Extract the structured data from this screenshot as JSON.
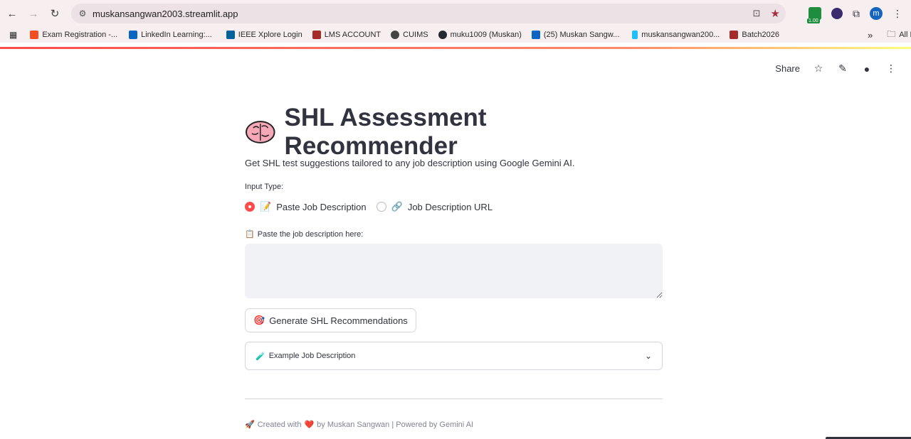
{
  "browser": {
    "url": "muskansangwan2003.streamlit.app",
    "back_icon": "arrow-left-icon",
    "forward_icon": "arrow-right-icon",
    "reload_icon": "reload-icon",
    "extension_badge": "1.00",
    "avatar_letter": "m"
  },
  "bookmarks": [
    {
      "label": "Exam Registration -...",
      "color": "#f25022"
    },
    {
      "label": "LinkedIn Learning:...",
      "color": "#0a66c2"
    },
    {
      "label": "IEEE Xplore Login",
      "color": "#00629b"
    },
    {
      "label": "LMS ACCOUNT",
      "color": "#a52a2a"
    },
    {
      "label": "CUIMS",
      "color": "#444444"
    },
    {
      "label": "muku1009 (Muskan)",
      "color": "#24292f"
    },
    {
      "label": "(25) Muskan Sangw...",
      "color": "#0a66c2"
    },
    {
      "label": "muskansangwan200...",
      "color": "#20beff"
    },
    {
      "label": "Batch2026",
      "color": "#a52a2a"
    }
  ],
  "all_bookmarks": "All Bookmarks",
  "st_header": {
    "share": "Share"
  },
  "main": {
    "title": "SHL Assessment Recommender",
    "subtitle": "Get SHL test suggestions tailored to any job description using Google Gemini AI.",
    "input_type_label": "Input Type:",
    "radio_options": [
      {
        "emoji": "📝",
        "label": "Paste Job Description",
        "selected": true
      },
      {
        "emoji": "🔗",
        "label": "Job Description URL",
        "selected": false
      }
    ],
    "textarea_emoji": "📋",
    "textarea_label": "Paste the job description here:",
    "textarea_value": "",
    "button_emoji": "🎯",
    "button_label": "Generate SHL Recommendations",
    "expander_emoji": "🧪",
    "expander_label": "Example Job Description",
    "footer_rocket": "🚀",
    "footer_pre": "Created with",
    "footer_heart": "❤️",
    "footer_post": "by Muskan Sangwan | Powered by Gemini AI"
  },
  "colors": {
    "accent": "#ff4b4b",
    "text": "#31333f",
    "input_bg": "#f0f2f6"
  }
}
